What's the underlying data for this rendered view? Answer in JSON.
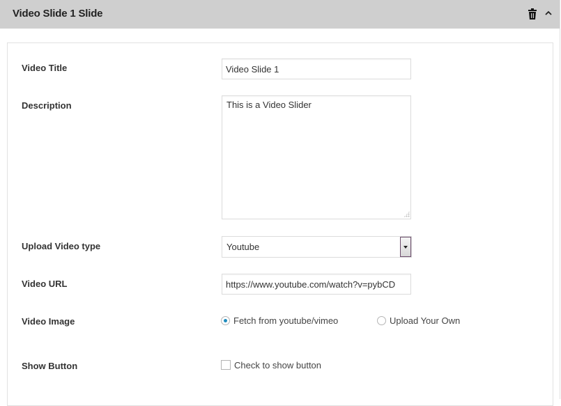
{
  "header": {
    "title": "Video Slide 1 Slide",
    "icons": [
      "trash-icon",
      "chevron-up-icon"
    ]
  },
  "form": {
    "video_title": {
      "label": "Video Title",
      "value": "Video Slide 1"
    },
    "description": {
      "label": "Description",
      "value": "This is a Video Slider"
    },
    "upload_video_type": {
      "label": "Upload Video type",
      "selected": "Youtube"
    },
    "video_url": {
      "label": "Video URL",
      "value": "https://www.youtube.com/watch?v=pybCD"
    },
    "video_image": {
      "label": "Video Image",
      "options": [
        {
          "label": "Fetch from youtube/vimeo",
          "checked": true
        },
        {
          "label": "Upload Your Own",
          "checked": false
        }
      ]
    },
    "show_button": {
      "label": "Show Button",
      "checkbox_label": "Check to show button",
      "checked": false
    }
  },
  "colors": {
    "header_bg": "#cfcfcf",
    "radio_accent": "#1e8cbe"
  }
}
